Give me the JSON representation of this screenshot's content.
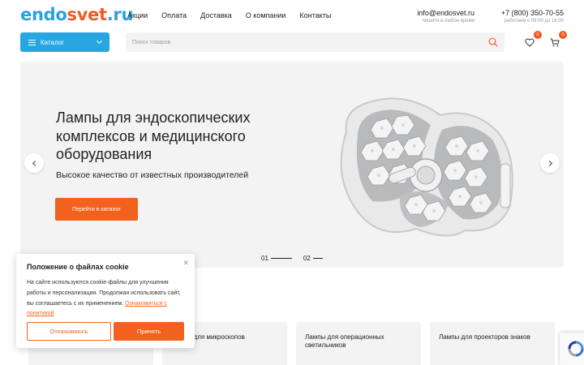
{
  "header": {
    "logo": {
      "part1": "endo",
      "part2": "svet",
      "part3": ".ru"
    },
    "nav": [
      "Акции",
      "Оплата",
      "Доставка",
      "О компании",
      "Контакты"
    ],
    "email": "info@endosvet.ru",
    "email_note": "пишите в любое время",
    "phone": "+7 (800) 350-70-55",
    "phone_note": "работаем с 09:00 до 18:00"
  },
  "toolbar": {
    "catalog_label": "Каталог",
    "search_placeholder": "Поиск товаров",
    "favorites_count": "0",
    "cart_count": "0"
  },
  "hero": {
    "title": "Лампы для эндоскопических комплексов и медицинского оборудования",
    "subtitle": "Высокое качество от известных производителей",
    "cta": "Перейти в каталог",
    "slides": [
      "01",
      "02"
    ],
    "active_slide": 1
  },
  "categories": [
    "Лампы для микроскопов",
    "Лампы для операционных светильников",
    "Лампы для проекторов знаков"
  ],
  "cookie": {
    "title": "Положение о файлах cookie",
    "text": "На сайте используются cookie-файлы для улучшения работы и персонализации. Продолжая использовать сайт, вы соглашаетесь с их применением.",
    "link": "Ознакомиться с политикой",
    "refuse": "Отказываюсь",
    "accept": "Принять"
  },
  "colors": {
    "brand_blue": "#27a6e1",
    "brand_orange": "#f2621d",
    "panel_gray": "#f3f3f3"
  }
}
